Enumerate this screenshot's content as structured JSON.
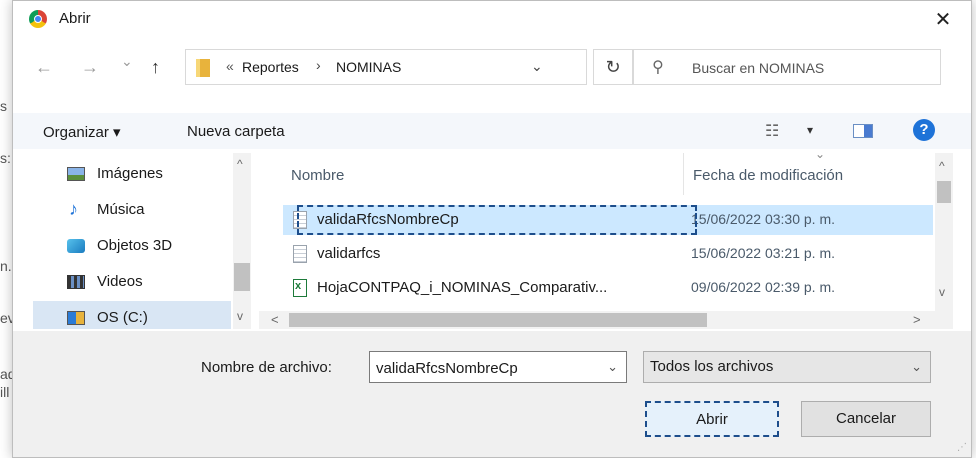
{
  "background_fragments": [
    "s",
    "s:",
    "n.",
    "ev",
    "ad",
    "ill"
  ],
  "dialog": {
    "title": "Abrir",
    "close_glyph": "✕"
  },
  "navbar": {
    "back_glyph": "←",
    "forward_glyph": "→",
    "recent_glyph": "⌄",
    "up_glyph": "↑",
    "breadcrumb_prefix": "«",
    "breadcrumb": [
      "Reportes",
      "NOMINAS"
    ],
    "breadcrumb_separator": "›",
    "dropdown_glyph": "⌄",
    "refresh_glyph": "↻",
    "search_placeholder": "Buscar en NOMINAS"
  },
  "toolbar": {
    "organize_label": "Organizar ▾",
    "new_folder_label": "Nueva carpeta",
    "view_glyph": "☷",
    "view_dropdown_glyph": "▾",
    "help_glyph": "?"
  },
  "nav_pane": {
    "items": [
      {
        "label": "Imágenes",
        "icon": "pictures-icon"
      },
      {
        "label": "Música",
        "icon": "music-icon"
      },
      {
        "label": "Objetos 3D",
        "icon": "objects-3d-icon"
      },
      {
        "label": "Videos",
        "icon": "videos-icon"
      },
      {
        "label": "OS (C:)",
        "icon": "drive-icon"
      }
    ],
    "scroll_up_glyph": "^",
    "scroll_down_glyph": "v"
  },
  "file_list": {
    "columns": [
      "Nombre",
      "Fecha de modificación"
    ],
    "sort_glyph": "⌄",
    "rows": [
      {
        "name": "validaRfcsNombreCp",
        "date": "15/06/2022 03:30 p. m.",
        "type": "text"
      },
      {
        "name": "validarfcs",
        "date": "15/06/2022 03:21 p. m.",
        "type": "text"
      },
      {
        "name": "HojaCONTPAQ_i_NOMINAS_Comparativ...",
        "date": "09/06/2022 02:39 p. m.",
        "type": "excel"
      }
    ],
    "scroll_up_glyph": "^",
    "scroll_down_glyph": "v",
    "scroll_left_glyph": "<",
    "scroll_right_glyph": ">"
  },
  "bottom": {
    "filename_label": "Nombre de archivo:",
    "filename_value": "validaRfcsNombreCp",
    "dropdown_glyph": "⌄",
    "file_type": "Todos los archivos",
    "open_label": "Abrir",
    "cancel_label": "Cancelar"
  },
  "colors": {
    "selected_row": "#cce8ff",
    "focus_border": "#1d4e8c",
    "toolbar_bg": "#f4f7fb",
    "bottom_bg": "#f0f0f0",
    "help_blue": "#1e73d8"
  }
}
